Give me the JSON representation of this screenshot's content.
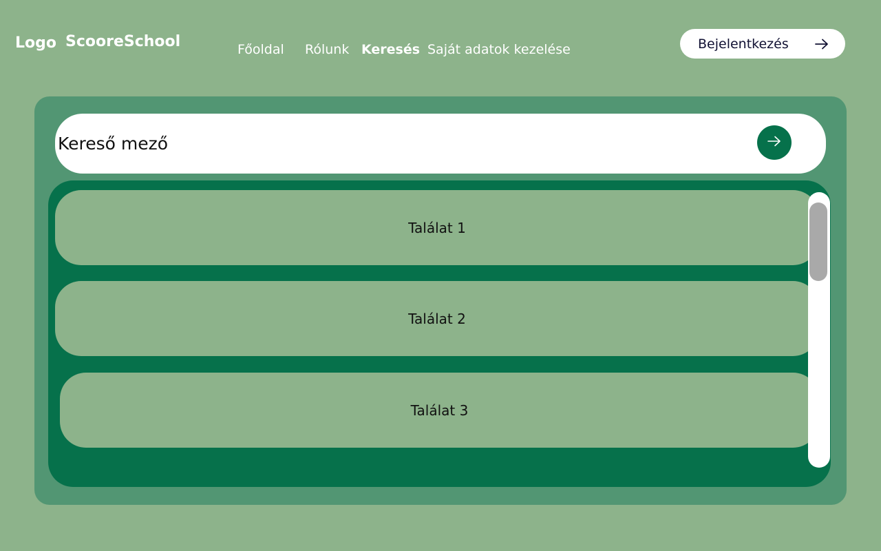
{
  "header": {
    "logo": "Logo",
    "brand": "ScooreSchool",
    "nav": {
      "home": "Főoldal",
      "about": "Rólunk",
      "search": "Keresés",
      "data": "Saját adatok kezelése"
    },
    "login_label": "Bejelentkezés",
    "login_icon": "arrow-right-icon"
  },
  "search": {
    "placeholder": "Kereső mező",
    "submit_icon": "arrow-right-icon"
  },
  "results": [
    {
      "label": "Találat 1"
    },
    {
      "label": "Találat 2"
    },
    {
      "label": "Találat 3"
    }
  ],
  "colors": {
    "background": "#8db38b",
    "panel": "#529673",
    "accent": "#06714b",
    "result": "#8db38b"
  }
}
